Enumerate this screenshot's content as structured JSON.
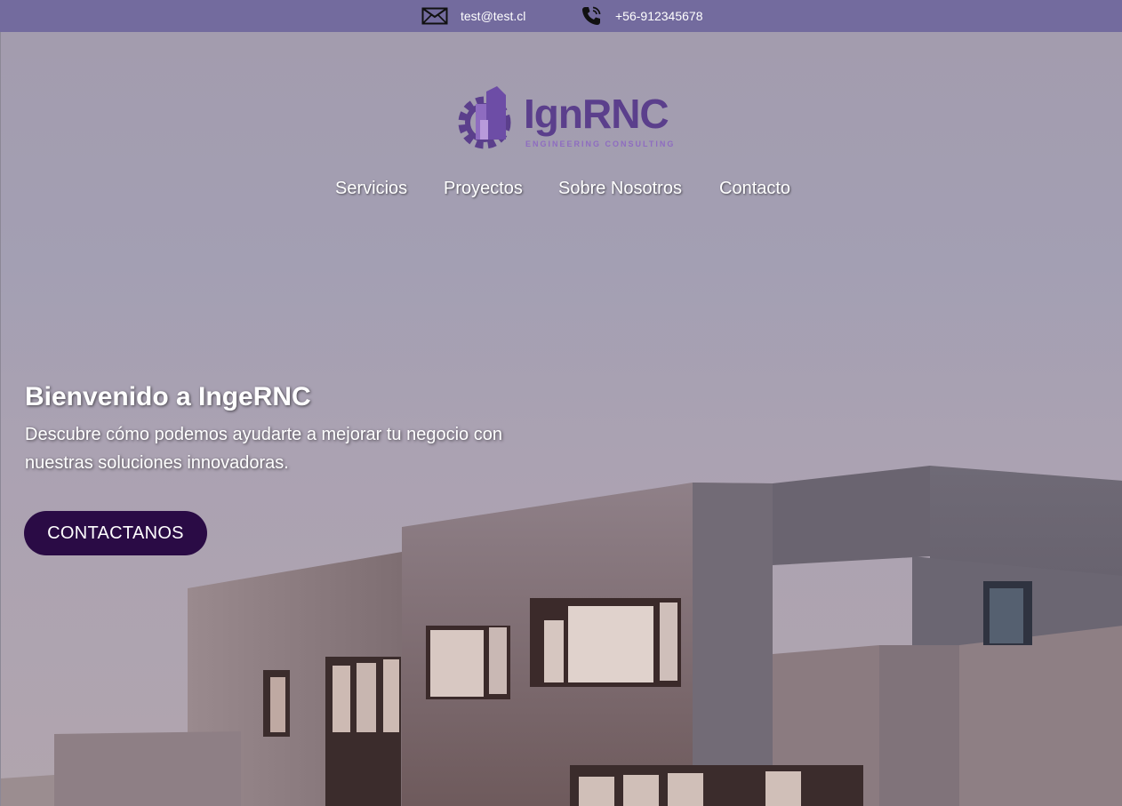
{
  "topbar": {
    "email_icon": "envelope-icon",
    "email": "test@test.cl",
    "phone_icon": "phone-icon",
    "phone": "+56-912345678"
  },
  "brand": {
    "logo_icon": "gear-building-icon",
    "name": "IgnRNC",
    "tagline": "ENGINEERING CONSULTING",
    "color": "#5b3f8c"
  },
  "nav": {
    "items": [
      {
        "label": "Servicios"
      },
      {
        "label": "Proyectos"
      },
      {
        "label": "Sobre Nosotros"
      },
      {
        "label": "Contacto"
      }
    ]
  },
  "hero": {
    "title": "Bienvenido a IngeRNC",
    "subtitle": "Descubre cómo podemos ayudarte a mejorar tu negocio con nuestras soluciones innovadoras.",
    "cta_label": "CONTACTANOS",
    "cta_color": "#2a0b45"
  },
  "colors": {
    "topbar": "#736b9e"
  }
}
